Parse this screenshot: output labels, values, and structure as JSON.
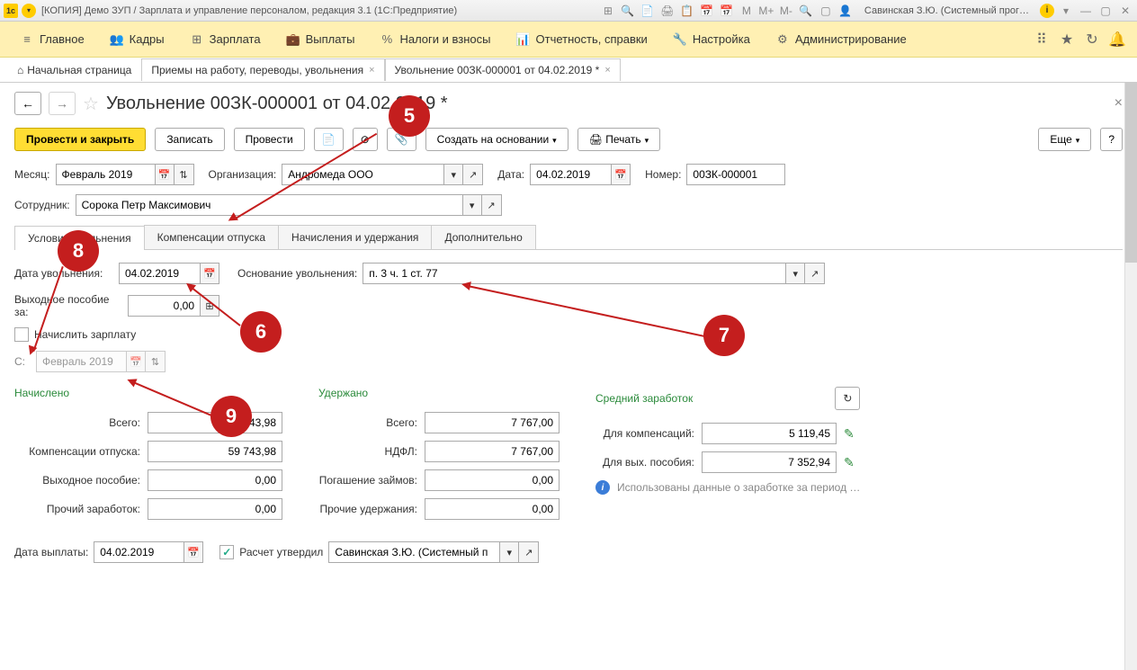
{
  "titlebar": {
    "title": "[КОПИЯ] Демо ЗУП / Зарплата и управление персоналом, редакция 3.1  (1С:Предприятие)",
    "user": "Савинская З.Ю. (Системный прог…",
    "m_labels": [
      "M",
      "M+",
      "M-"
    ]
  },
  "mainmenu": {
    "items": [
      {
        "icon": "≡",
        "label": "Главное"
      },
      {
        "icon": "👥",
        "label": "Кадры"
      },
      {
        "icon": "⊞",
        "label": "Зарплата"
      },
      {
        "icon": "💼",
        "label": "Выплаты"
      },
      {
        "icon": "%",
        "label": "Налоги и взносы"
      },
      {
        "icon": "📊",
        "label": "Отчетность, справки"
      },
      {
        "icon": "🔧",
        "label": "Настройка"
      },
      {
        "icon": "⚙",
        "label": "Администрирование"
      }
    ]
  },
  "tabs": {
    "home": "Начальная страница",
    "t1": "Приемы на работу, переводы, увольнения",
    "t2": "Увольнение 00ЗК-000001 от 04.02.2019 *"
  },
  "page": {
    "title": "Увольнение 00ЗК-000001 от 04.02.2019 *"
  },
  "toolbar": {
    "post_close": "Провести и закрыть",
    "save": "Записать",
    "post": "Провести",
    "create_based": "Создать на основании",
    "print": "Печать",
    "more": "Еще"
  },
  "header_form": {
    "month_label": "Месяц:",
    "month_value": "Февраль 2019",
    "org_label": "Организация:",
    "org_value": "Андромеда ООО",
    "date_label": "Дата:",
    "date_value": "04.02.2019",
    "number_label": "Номер:",
    "number_value": "00ЗК-000001",
    "employee_label": "Сотрудник:",
    "employee_value": "Сорока Петр Максимович"
  },
  "doc_tabs": {
    "t0": "Условия увольнения",
    "t1": "Компенсации отпуска",
    "t2": "Начисления и удержания",
    "t3": "Дополнительно"
  },
  "dismissal": {
    "date_label": "Дата увольнения:",
    "date_value": "04.02.2019",
    "reason_label": "Основание увольнения:",
    "reason_value": "п. 3 ч. 1 ст. 77",
    "severance_label": "Выходное пособие за:",
    "severance_value": "0,00",
    "calc_salary_label": "Начислить зарплату",
    "from_label": "С:",
    "from_value": "Февраль 2019"
  },
  "calc": {
    "accrued_header": "Начислено",
    "withheld_header": "Удержано",
    "avg_header": "Средний заработок",
    "total_label": "Всего:",
    "accrued_total": "59 743,98",
    "vacation_comp_label": "Компенсации отпуска:",
    "vacation_comp_value": "59 743,98",
    "severance_pay_label": "Выходное пособие:",
    "severance_pay_value": "0,00",
    "other_income_label": "Прочий заработок:",
    "other_income_value": "0,00",
    "withheld_total": "7 767,00",
    "ndfl_label": "НДФЛ:",
    "ndfl_value": "7 767,00",
    "loan_label": "Погашение займов:",
    "loan_value": "0,00",
    "other_withheld_label": "Прочие удержания:",
    "other_withheld_value": "0,00",
    "for_comp_label": "Для компенсаций:",
    "for_comp_value": "5 119,45",
    "for_sev_label": "Для вых. пособия:",
    "for_sev_value": "7 352,94",
    "info_text": "Использованы данные о заработке за период …"
  },
  "footer": {
    "payout_date_label": "Дата выплаты:",
    "payout_date_value": "04.02.2019",
    "approved_label": "Расчет утвердил",
    "approved_by": "Савинская З.Ю. (Системный п"
  },
  "annotations": {
    "a5": "5",
    "a6": "6",
    "a7": "7",
    "a8": "8",
    "a9": "9"
  }
}
